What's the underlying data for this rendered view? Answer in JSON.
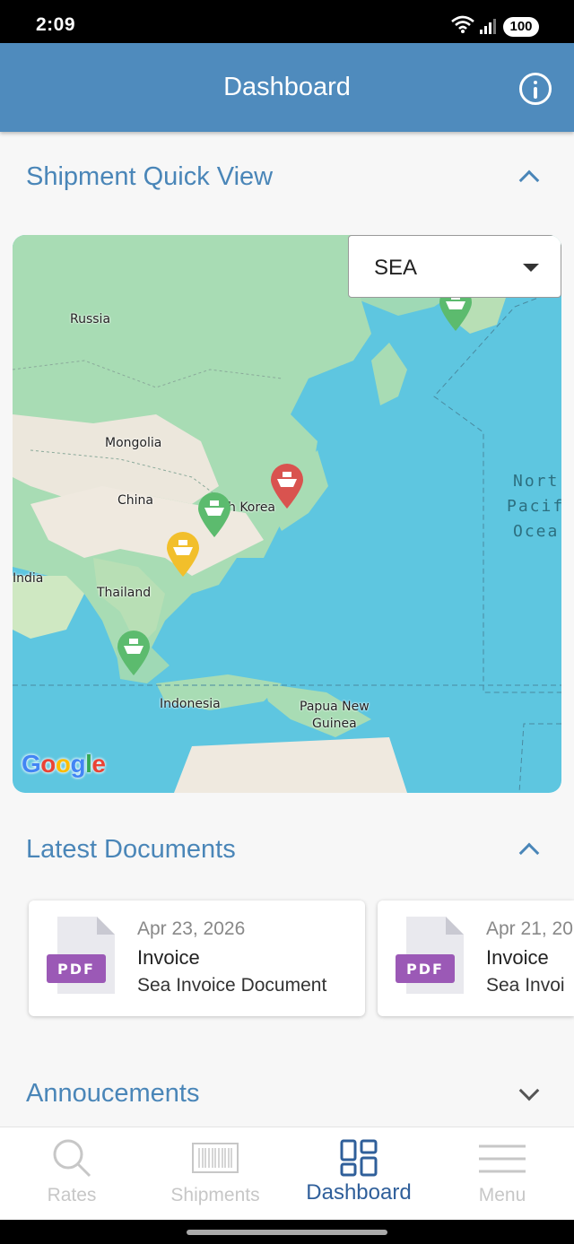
{
  "status_bar": {
    "time": "2:09",
    "battery": "100"
  },
  "app_bar": {
    "title": "Dashboard",
    "info_icon": "info-icon"
  },
  "shipment_quick_view": {
    "title": "Shipment Quick View",
    "mode_select": {
      "value": "SEA"
    },
    "map": {
      "labels": [
        "Russia",
        "Mongolia",
        "China",
        "h Korea",
        "India",
        "Thailand",
        "Indonesia",
        "Papua New",
        "Guinea"
      ],
      "ocean_label": [
        "Nort",
        "Pacif",
        "Ocea"
      ],
      "logo": "Google",
      "pins": [
        {
          "status": "green",
          "icon": "ship-icon"
        },
        {
          "status": "red",
          "icon": "ship-icon"
        },
        {
          "status": "green",
          "icon": "ship-icon"
        },
        {
          "status": "yellow",
          "icon": "ship-icon"
        },
        {
          "status": "green",
          "icon": "ship-icon"
        }
      ]
    }
  },
  "latest_documents": {
    "title": "Latest Documents",
    "documents": [
      {
        "date": "Apr 23, 2026",
        "type": "Invoice",
        "description": "Sea Invoice Document",
        "file_badge": "PDF"
      },
      {
        "date": "Apr 21, 20",
        "type": "Invoice",
        "description": "Sea Invoi",
        "file_badge": "PDF"
      }
    ]
  },
  "announcements": {
    "title": "Annoucements"
  },
  "bottom_nav": {
    "items": [
      {
        "label": "Rates",
        "icon": "search-icon"
      },
      {
        "label": "Shipments",
        "icon": "barcode-icon"
      },
      {
        "label": "Dashboard",
        "icon": "dashboard-icon"
      },
      {
        "label": "Menu",
        "icon": "menu-icon"
      }
    ],
    "active": "Dashboard"
  },
  "colors": {
    "app_bar": "#4f8bbd",
    "accent_text": "#4a86b8",
    "nav_active": "#2f5f9a",
    "pin_green": "#5cbb6e",
    "pin_red": "#d9534f",
    "pin_yellow": "#f2bf2b",
    "pdf_badge": "#9b59b6"
  }
}
